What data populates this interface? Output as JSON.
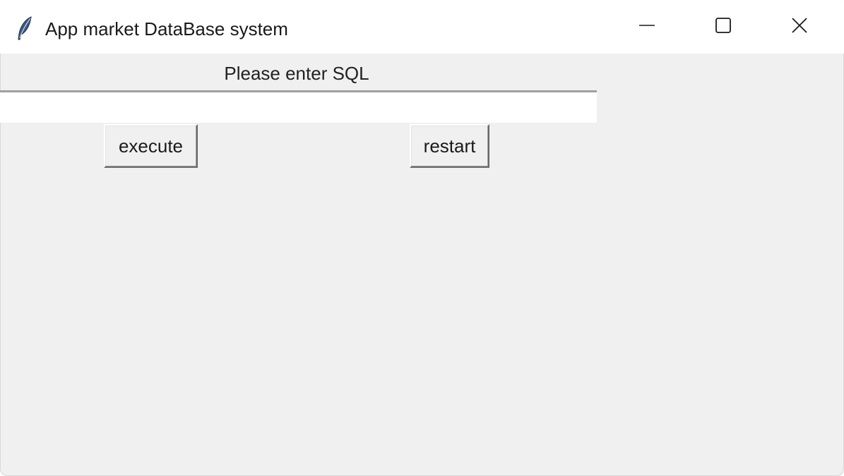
{
  "window": {
    "title": "App market DataBase system",
    "app_icon": "feather-icon",
    "controls": {
      "minimize": "minimize-icon",
      "maximize": "maximize-icon",
      "close": "close-icon"
    }
  },
  "main": {
    "prompt_label": "Please enter SQL",
    "sql_input": {
      "value": "",
      "placeholder": ""
    },
    "buttons": {
      "execute_label": "execute",
      "restart_label": "restart"
    }
  },
  "colors": {
    "window_bg": "#f0f0f0",
    "titlebar_bg": "#ffffff",
    "entry_bg": "#ffffff"
  }
}
